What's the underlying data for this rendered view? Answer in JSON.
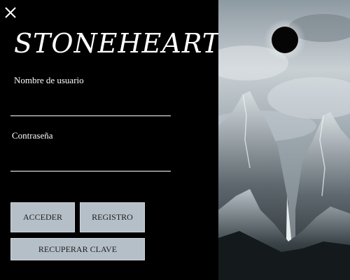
{
  "app": {
    "logo_text": "STONEHEARTH"
  },
  "login_form": {
    "username_label": "Nombre de usuario",
    "username_value": "",
    "password_label": "Contraseña",
    "password_value": "",
    "login_button": "ACCEDER",
    "register_button": "REGISTRO",
    "recover_button": "RECUPERAR CLAVE"
  },
  "icons": {
    "close": "close-icon",
    "artwork": "mountain-landscape-image"
  },
  "colors": {
    "background": "#000000",
    "text": "#ffffff",
    "button_bg": "#b5bfc8",
    "button_text": "#1e1e1e"
  }
}
